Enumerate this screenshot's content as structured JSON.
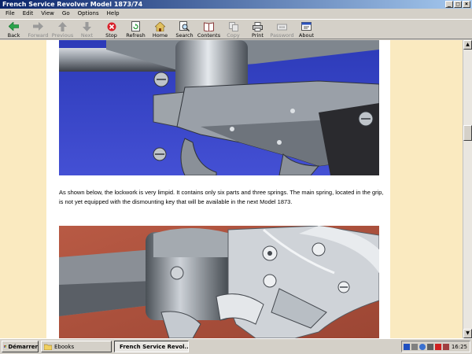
{
  "window": {
    "title": "French Service Revolver Model 1873/74"
  },
  "menu": [
    "File",
    "Edit",
    "View",
    "Go",
    "Options",
    "Help"
  ],
  "toolbar": [
    {
      "label": "Back",
      "icon": "back-arrow-icon",
      "enabled": true
    },
    {
      "label": "Forward",
      "icon": "forward-arrow-icon",
      "enabled": false
    },
    {
      "label": "Previous",
      "icon": "up-arrow-icon",
      "enabled": false
    },
    {
      "label": "Next",
      "icon": "down-arrow-icon",
      "enabled": false
    },
    {
      "label": "Stop",
      "icon": "stop-icon",
      "enabled": true
    },
    {
      "label": "Refresh",
      "icon": "refresh-icon",
      "enabled": true
    },
    {
      "label": "Home",
      "icon": "home-icon",
      "enabled": true
    },
    {
      "label": "Search",
      "icon": "search-icon",
      "enabled": true
    },
    {
      "label": "Contents",
      "icon": "contents-icon",
      "enabled": true
    },
    {
      "label": "Copy",
      "icon": "copy-icon",
      "enabled": false
    },
    {
      "label": "Print",
      "icon": "print-icon",
      "enabled": true
    },
    {
      "label": "Password",
      "icon": "password-icon",
      "enabled": false
    },
    {
      "label": "About",
      "icon": "about-icon",
      "enabled": true
    }
  ],
  "content": {
    "paragraph": "As shown below, the lockwork is very limpid. It contains only six parts and three springs. The main spring, located in the grip, is not yet equipped with the dismounting key that will be available in the next Model 1873."
  },
  "taskbar": {
    "start_label": "Démarrer",
    "tasks": [
      {
        "label": "Ebooks",
        "active": false
      },
      {
        "label": "French Service Revol...",
        "active": true
      }
    ],
    "clock": "16:25"
  },
  "colors": {
    "page_bg": "#faeac0",
    "photo1_bg": "#2f3fc4",
    "photo2_bg": "#b0533f",
    "title_bar": "#0a246a"
  }
}
